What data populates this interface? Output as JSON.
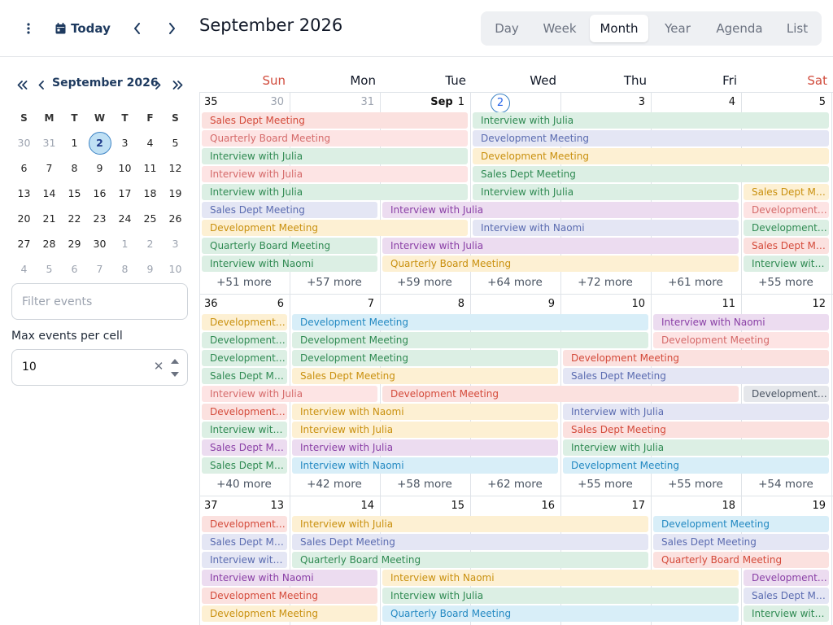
{
  "toolbar": {
    "today_label": "Today",
    "title": "September 2026",
    "views": [
      "Day",
      "Week",
      "Month",
      "Year",
      "Agenda",
      "List"
    ],
    "active_view": "Month"
  },
  "mini_calendar": {
    "title": "September 2026",
    "weekdays": [
      "S",
      "M",
      "T",
      "W",
      "T",
      "F",
      "S"
    ],
    "weeks": [
      [
        [
          "30",
          1
        ],
        [
          "31",
          1
        ],
        [
          "1",
          0
        ],
        [
          "2",
          0
        ],
        [
          "3",
          0
        ],
        [
          "4",
          0
        ],
        [
          "5",
          0
        ]
      ],
      [
        [
          "6",
          0
        ],
        [
          "7",
          0
        ],
        [
          "8",
          0
        ],
        [
          "9",
          0
        ],
        [
          "10",
          0
        ],
        [
          "11",
          0
        ],
        [
          "12",
          0
        ]
      ],
      [
        [
          "13",
          0
        ],
        [
          "14",
          0
        ],
        [
          "15",
          0
        ],
        [
          "16",
          0
        ],
        [
          "17",
          0
        ],
        [
          "18",
          0
        ],
        [
          "19",
          0
        ]
      ],
      [
        [
          "20",
          0
        ],
        [
          "21",
          0
        ],
        [
          "22",
          0
        ],
        [
          "23",
          0
        ],
        [
          "24",
          0
        ],
        [
          "25",
          0
        ],
        [
          "26",
          0
        ]
      ],
      [
        [
          "27",
          0
        ],
        [
          "28",
          0
        ],
        [
          "29",
          0
        ],
        [
          "30",
          0
        ],
        [
          "1",
          1
        ],
        [
          "2",
          1
        ],
        [
          "3",
          1
        ]
      ],
      [
        [
          "4",
          1
        ],
        [
          "5",
          1
        ],
        [
          "6",
          1
        ],
        [
          "7",
          1
        ],
        [
          "8",
          1
        ],
        [
          "9",
          1
        ],
        [
          "10",
          1
        ]
      ]
    ],
    "today": "2"
  },
  "filter": {
    "placeholder": "Filter events"
  },
  "max_events": {
    "label": "Max events per cell",
    "value": "10"
  },
  "calendar": {
    "weekday_headers": [
      "Sun",
      "Mon",
      "Tue",
      "Wed",
      "Thu",
      "Fri",
      "Sat"
    ],
    "colors": {
      "red": [
        "#fbe1df",
        "#d44a3a"
      ],
      "green": [
        "#dcefe4",
        "#2f8a52"
      ],
      "lav": [
        "#e4e6f4",
        "#5a6bb0"
      ],
      "yellow": [
        "#fdf0d3",
        "#c9900e"
      ],
      "purple": [
        "#ecdcf0",
        "#8a3fa6"
      ],
      "pink": [
        "#fde4e4",
        "#d56a6a"
      ],
      "blue": [
        "#d8eef8",
        "#2389c2"
      ],
      "gray": [
        "#e5e7eb",
        "#4b5563"
      ]
    },
    "weeks": [
      {
        "week_number": "35",
        "days": [
          {
            "n": "30",
            "other": true
          },
          {
            "n": "31",
            "other": true
          },
          {
            "n": "1",
            "prefix": "Sep"
          },
          {
            "n": "2",
            "today": true
          },
          {
            "n": "3"
          },
          {
            "n": "4"
          },
          {
            "n": "5"
          }
        ],
        "events": [
          {
            "t": "Sales Dept Meeting",
            "c": "red",
            "s": 0,
            "e": 2,
            "r": 0
          },
          {
            "t": "Quarterly Board Meeting",
            "c": "pink",
            "s": 0,
            "e": 2,
            "r": 1
          },
          {
            "t": "Interview with Julia",
            "c": "green",
            "s": 0,
            "e": 2,
            "r": 2
          },
          {
            "t": "Interview with Julia",
            "c": "pink",
            "s": 0,
            "e": 2,
            "r": 3
          },
          {
            "t": "Interview with Julia",
            "c": "green",
            "s": 0,
            "e": 2,
            "r": 4
          },
          {
            "t": "Sales Dept Meeting",
            "c": "lav",
            "s": 0,
            "e": 1,
            "r": 5
          },
          {
            "t": "Development Meeting",
            "c": "yellow",
            "s": 0,
            "e": 2,
            "r": 6
          },
          {
            "t": "Quarterly Board Meeting",
            "c": "green",
            "s": 0,
            "e": 1,
            "r": 7
          },
          {
            "t": "Interview with Naomi",
            "c": "green",
            "s": 0,
            "e": 1,
            "r": 8
          },
          {
            "t": "Interview with Julia",
            "c": "green",
            "s": 3,
            "e": 6,
            "r": 0
          },
          {
            "t": "Development Meeting",
            "c": "lav",
            "s": 3,
            "e": 6,
            "r": 1
          },
          {
            "t": "Development Meeting",
            "c": "yellow",
            "s": 3,
            "e": 6,
            "r": 2
          },
          {
            "t": "Sales Dept Meeting",
            "c": "green",
            "s": 3,
            "e": 6,
            "r": 3
          },
          {
            "t": "Interview with Julia",
            "c": "green",
            "s": 3,
            "e": 5,
            "r": 4
          },
          {
            "t": "Sales Dept Meeting",
            "c": "yellow",
            "s": 6,
            "e": 6,
            "r": 4
          },
          {
            "t": "Interview with Julia",
            "c": "purple",
            "s": 2,
            "e": 5,
            "r": 5
          },
          {
            "t": "Development Meeting",
            "c": "pink",
            "s": 6,
            "e": 6,
            "r": 5
          },
          {
            "t": "Interview with Naomi",
            "c": "lav",
            "s": 3,
            "e": 5,
            "r": 6
          },
          {
            "t": "Development Meeting",
            "c": "green",
            "s": 6,
            "e": 6,
            "r": 6
          },
          {
            "t": "Interview with Julia",
            "c": "purple",
            "s": 2,
            "e": 5,
            "r": 7
          },
          {
            "t": "Sales Dept Meeting",
            "c": "red",
            "s": 6,
            "e": 6,
            "r": 7
          },
          {
            "t": "Quarterly Board Meeting",
            "c": "yellow",
            "s": 2,
            "e": 5,
            "r": 8
          },
          {
            "t": "Interview with Naomi",
            "c": "green",
            "s": 6,
            "e": 6,
            "r": 8
          }
        ],
        "more": [
          "+51 more",
          "+57 more",
          "+59 more",
          "+64 more",
          "+72 more",
          "+61 more",
          "+55 more"
        ]
      },
      {
        "week_number": "36",
        "days": [
          {
            "n": "6"
          },
          {
            "n": "7"
          },
          {
            "n": "8"
          },
          {
            "n": "9"
          },
          {
            "n": "10"
          },
          {
            "n": "11"
          },
          {
            "n": "12"
          }
        ],
        "events": [
          {
            "t": "Development Meeting",
            "c": "yellow",
            "s": 0,
            "e": 0,
            "r": 0
          },
          {
            "t": "Development Meeting",
            "c": "blue",
            "s": 1,
            "e": 4,
            "r": 0
          },
          {
            "t": "Interview with Naomi",
            "c": "purple",
            "s": 5,
            "e": 6,
            "r": 0
          },
          {
            "t": "Development Meeting",
            "c": "green",
            "s": 0,
            "e": 0,
            "r": 1
          },
          {
            "t": "Development Meeting",
            "c": "green",
            "s": 1,
            "e": 4,
            "r": 1
          },
          {
            "t": "Development Meeting",
            "c": "pink",
            "s": 5,
            "e": 6,
            "r": 1
          },
          {
            "t": "Development Meeting",
            "c": "green",
            "s": 0,
            "e": 0,
            "r": 2
          },
          {
            "t": "Development Meeting",
            "c": "green",
            "s": 1,
            "e": 3,
            "r": 2
          },
          {
            "t": "Development Meeting",
            "c": "red",
            "s": 4,
            "e": 6,
            "r": 2
          },
          {
            "t": "Sales Dept Meeting",
            "c": "green",
            "s": 0,
            "e": 0,
            "r": 3
          },
          {
            "t": "Sales Dept Meeting",
            "c": "yellow",
            "s": 1,
            "e": 3,
            "r": 3
          },
          {
            "t": "Sales Dept Meeting",
            "c": "lav",
            "s": 4,
            "e": 6,
            "r": 3
          },
          {
            "t": "Interview with Julia",
            "c": "pink",
            "s": 0,
            "e": 1,
            "r": 4
          },
          {
            "t": "Development Meeting",
            "c": "red",
            "s": 2,
            "e": 5,
            "r": 4
          },
          {
            "t": "Development Meeting",
            "c": "gray",
            "s": 6,
            "e": 6,
            "r": 4
          },
          {
            "t": "Development Meeting",
            "c": "red",
            "s": 0,
            "e": 0,
            "r": 5
          },
          {
            "t": "Interview with Naomi",
            "c": "yellow",
            "s": 1,
            "e": 3,
            "r": 5
          },
          {
            "t": "Interview with Julia",
            "c": "lav",
            "s": 4,
            "e": 6,
            "r": 5
          },
          {
            "t": "Interview with Julia",
            "c": "green",
            "s": 0,
            "e": 0,
            "r": 6
          },
          {
            "t": "Interview with Julia",
            "c": "yellow",
            "s": 1,
            "e": 3,
            "r": 6
          },
          {
            "t": "Sales Dept Meeting",
            "c": "red",
            "s": 4,
            "e": 6,
            "r": 6
          },
          {
            "t": "Sales Dept Meeting",
            "c": "purple",
            "s": 0,
            "e": 0,
            "r": 7
          },
          {
            "t": "Interview with Julia",
            "c": "purple",
            "s": 1,
            "e": 3,
            "r": 7
          },
          {
            "t": "Interview with Julia",
            "c": "green",
            "s": 4,
            "e": 6,
            "r": 7
          },
          {
            "t": "Sales Dept Meeting",
            "c": "green",
            "s": 0,
            "e": 0,
            "r": 8
          },
          {
            "t": "Interview with Naomi",
            "c": "blue",
            "s": 1,
            "e": 3,
            "r": 8
          },
          {
            "t": "Development Meeting",
            "c": "blue",
            "s": 4,
            "e": 6,
            "r": 8
          }
        ],
        "more": [
          "+40 more",
          "+42 more",
          "+58 more",
          "+62 more",
          "+55 more",
          "+55 more",
          "+54 more"
        ]
      },
      {
        "week_number": "37",
        "days": [
          {
            "n": "13"
          },
          {
            "n": "14"
          },
          {
            "n": "15"
          },
          {
            "n": "16"
          },
          {
            "n": "17"
          },
          {
            "n": "18"
          },
          {
            "n": "19"
          }
        ],
        "events": [
          {
            "t": "Development Meeting",
            "c": "red",
            "s": 0,
            "e": 0,
            "r": 0
          },
          {
            "t": "Interview with Julia",
            "c": "yellow",
            "s": 1,
            "e": 4,
            "r": 0
          },
          {
            "t": "Development Meeting",
            "c": "blue",
            "s": 5,
            "e": 6,
            "r": 0
          },
          {
            "t": "Sales Dept Meeting",
            "c": "lav",
            "s": 0,
            "e": 0,
            "r": 1
          },
          {
            "t": "Sales Dept Meeting",
            "c": "lav",
            "s": 1,
            "e": 4,
            "r": 1
          },
          {
            "t": "Sales Dept Meeting",
            "c": "lav",
            "s": 5,
            "e": 6,
            "r": 1
          },
          {
            "t": "Interview with Julia",
            "c": "lav",
            "s": 0,
            "e": 0,
            "r": 2
          },
          {
            "t": "Quarterly Board Meeting",
            "c": "green",
            "s": 1,
            "e": 4,
            "r": 2
          },
          {
            "t": "Quarterly Board Meeting",
            "c": "red",
            "s": 5,
            "e": 6,
            "r": 2
          },
          {
            "t": "Interview with Naomi",
            "c": "purple",
            "s": 0,
            "e": 1,
            "r": 3
          },
          {
            "t": "Interview with Naomi",
            "c": "yellow",
            "s": 2,
            "e": 5,
            "r": 3
          },
          {
            "t": "Development Meeting",
            "c": "purple",
            "s": 6,
            "e": 6,
            "r": 3
          },
          {
            "t": "Development Meeting",
            "c": "red",
            "s": 0,
            "e": 1,
            "r": 4
          },
          {
            "t": "Interview with Julia",
            "c": "green",
            "s": 2,
            "e": 5,
            "r": 4
          },
          {
            "t": "Sales Dept Meeting",
            "c": "lav",
            "s": 6,
            "e": 6,
            "r": 4
          },
          {
            "t": "Development Meeting",
            "c": "yellow",
            "s": 0,
            "e": 1,
            "r": 5
          },
          {
            "t": "Quarterly Board Meeting",
            "c": "blue",
            "s": 2,
            "e": 5,
            "r": 5
          },
          {
            "t": "Interview with Julia",
            "c": "green",
            "s": 6,
            "e": 6,
            "r": 5
          }
        ],
        "more": []
      }
    ]
  }
}
